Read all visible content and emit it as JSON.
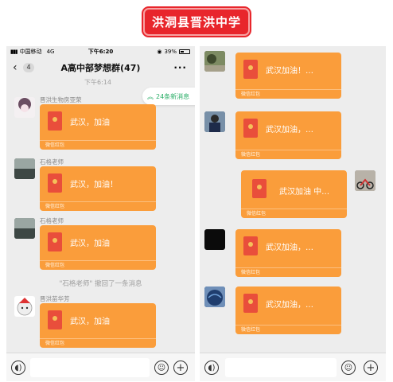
{
  "banner": {
    "title": "洪洞县晋洪中学"
  },
  "left_phone": {
    "status": {
      "carrier": "中国移动",
      "network": "4G",
      "time": "下午6:20",
      "battery": "39%"
    },
    "nav": {
      "back_count": "4",
      "title": "A高中部梦想群(47)"
    },
    "timestamp": "下午6:14",
    "new_messages": "24条新消息",
    "messages": [
      {
        "sender": "晋洪生物房亚荣",
        "text": "武汉，加油",
        "label": "微信红包"
      },
      {
        "sender": "石格老师",
        "text": "武汉，加油！",
        "label": "微信红包"
      },
      {
        "sender": "石格老师",
        "text": "武汉，加油",
        "label": "微信红包"
      },
      {
        "sender": "晋洪苗华芳",
        "text": "武汉，加油",
        "label": "微信红包"
      }
    ],
    "recall_notice": "\"石格老师\" 撤回了一条消息"
  },
  "right_phone": {
    "messages": [
      {
        "text": "武汉加油！…",
        "label": "微信红包"
      },
      {
        "text": "武汉加油，…",
        "label": "微信红包"
      },
      {
        "text": "武汉加油 中…",
        "label": "微信红包"
      },
      {
        "text": "武汉加油，…",
        "label": "微信红包"
      },
      {
        "text": "武汉加油，…",
        "label": "微信红包"
      }
    ]
  },
  "colors": {
    "accent": "#fa9d3b",
    "banner": "#e8262c",
    "new_msg": "#2aae67"
  }
}
